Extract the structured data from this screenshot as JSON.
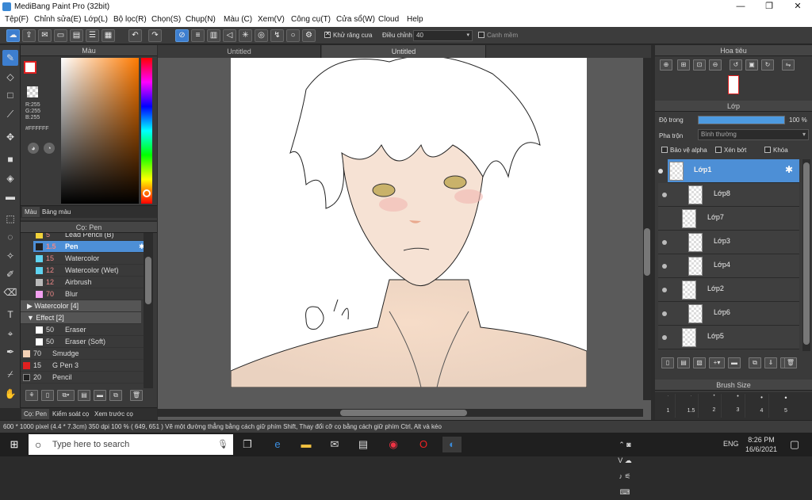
{
  "window": {
    "title": "MediBang Paint Pro (32bit)",
    "min": "—",
    "max": "❐",
    "close": "✕"
  },
  "menu": [
    "Tệp(F)",
    "Chỉnh sửa(E)",
    "Lớp(L)",
    "Bộ lọc(R)",
    "Chọn(S)",
    "Chụp(N)",
    "Màu (C)",
    "Xem(V)",
    "Công cụ(T)",
    "Cửa sổ(W)",
    "Cloud",
    "Help"
  ],
  "toolbar": {
    "antialias_label": "Khử răng cưa",
    "correction_label": "Điều chỉnh",
    "correction_value": "40",
    "snap_label": "Canh mềm"
  },
  "color_panel": {
    "title": "Màu",
    "r": "R:255",
    "g": "G:255",
    "b": "B:255",
    "hex": "#FFFFFF",
    "tab_color": "Màu",
    "tab_palette": "Bảng màu",
    "fg": "#ffffff",
    "bg": "#3d7ecf"
  },
  "brush_panel": {
    "title": "Cọ: Pen",
    "items": [
      {
        "num": "5",
        "name": "Lead Pencil (B)",
        "color": "#f2d23a"
      },
      {
        "num": "1.5",
        "name": "Pen",
        "color": "#222222",
        "selected": true
      },
      {
        "num": "15",
        "name": "Watercolor",
        "color": "#5fd3f0"
      },
      {
        "num": "12",
        "name": "Watercolor (Wet)",
        "color": "#5fd3f0"
      },
      {
        "num": "12",
        "name": "Airbrush",
        "color": "#bbbbbb"
      },
      {
        "num": "70",
        "name": "Blur",
        "color": "#f3a0f0"
      }
    ],
    "group_watercolor": "Watercolor [4]",
    "group_effect": "Effect [2]",
    "effect_items": [
      {
        "num": "50",
        "name": "Eraser",
        "color": "#ffffff"
      },
      {
        "num": "50",
        "name": "Eraser (Soft)",
        "color": "#ffffff"
      }
    ],
    "other_items": [
      {
        "num": "70",
        "name": "Smudge",
        "color": "#f3d1b6"
      },
      {
        "num": "15",
        "name": "G Pen 3",
        "color": "#e02020"
      },
      {
        "num": "20",
        "name": "Pencil",
        "color": "#222222"
      }
    ],
    "tab_brush": "Cọ: Pen",
    "tab_check": "Kiểm soát cọ",
    "tab_preview": "Xem trước cọ"
  },
  "canvas": {
    "tab1": "Untitled",
    "tab2": "Untitled"
  },
  "navigator": {
    "title": "Hoa tiêu"
  },
  "layer_panel": {
    "title": "Lớp",
    "opacity_label": "Độ trong",
    "opacity_value": "100 %",
    "blend_label": "Pha trộn",
    "blend_value": "Bình thường",
    "protect_alpha": "Bảo vệ alpha",
    "clip": "Xén bớt",
    "lock": "Khóa",
    "layers": [
      "Lớp1",
      "Lớp8",
      "Lớp7",
      "Lớp3",
      "Lớp4",
      "Lớp2",
      "Lớp6",
      "Lớp5"
    ]
  },
  "brush_size": {
    "title": "Brush Size",
    "sizes": [
      "1",
      "1.5",
      "2",
      "3",
      "4",
      "5"
    ]
  },
  "status": "600 * 1000 pixel   (4.4 * 7.3cm)   350 dpi   100 %   ( 649, 651 )   Vẽ một đường thẳng bằng cách giữ phím Shift, Thay đổi cỡ cọ bằng cách giữ phím Ctrl, Alt và kéo",
  "taskbar": {
    "search_placeholder": "Type here to search",
    "time": "8:26 PM",
    "date": "16/6/2021",
    "lang": "ENG"
  }
}
